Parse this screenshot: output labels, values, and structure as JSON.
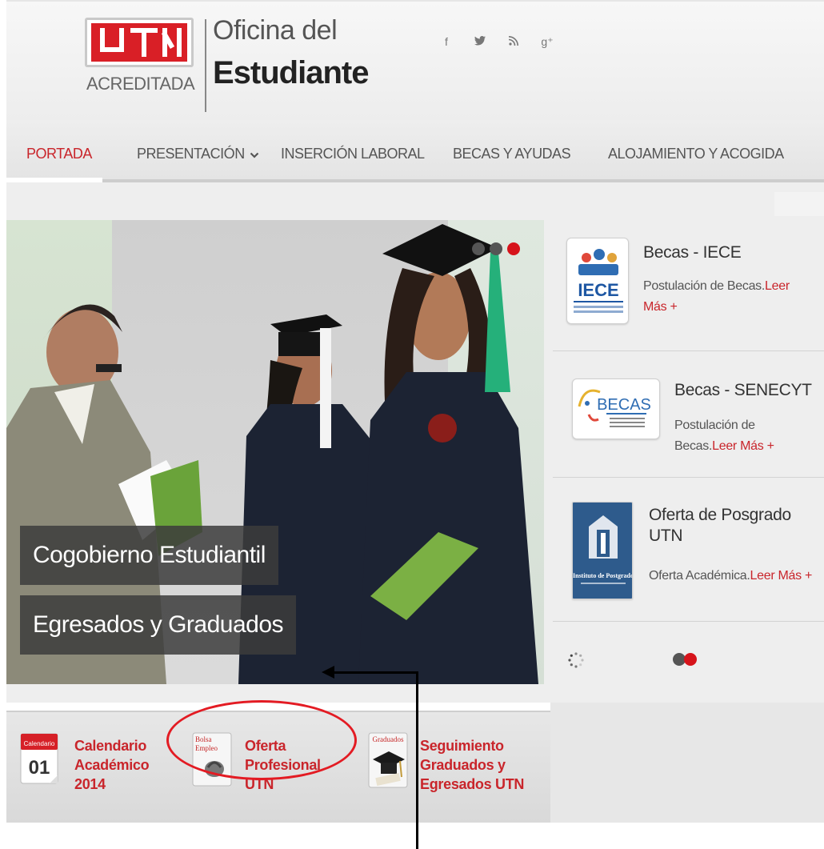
{
  "header": {
    "logo_mark": "UTN",
    "logo_subtitle": "ACREDITADA",
    "title_line1": "Oficina del",
    "title_line2": "Estudiante",
    "social": [
      {
        "icon": "facebook-icon",
        "glyph": "f"
      },
      {
        "icon": "twitter-icon",
        "glyph": "y"
      },
      {
        "icon": "rss-icon",
        "glyph": "≈"
      },
      {
        "icon": "google-plus-icon",
        "glyph": "g⁺"
      }
    ]
  },
  "nav": {
    "items": [
      {
        "label": "PORTADA",
        "active": true
      },
      {
        "label": "PRESENTACIÓN",
        "has_dropdown": true
      },
      {
        "label": "INSERCIÓN LABORAL"
      },
      {
        "label": "BECAS Y AYUDAS"
      },
      {
        "label": "ALOJAMIENTO Y ACOGIDA"
      }
    ],
    "dropdown_glyph": "⌄"
  },
  "slider": {
    "captions": [
      "Cogobierno Estudiantil",
      "Egresados y Graduados"
    ],
    "active_dot": 3,
    "dot_count": 3
  },
  "news": [
    {
      "title": "Becas - IECE",
      "text": "Postulación de Becas.",
      "link": "Leer Más +",
      "thumb_text": "IECE",
      "thumb_sub": "INSTITUTO ECUATORIANO DE CRÉDITO EDUCATIVO Y BECAS"
    },
    {
      "title": "Becas - SENECYT",
      "text": "Postulación de Becas.",
      "link": "Leer Más +",
      "thumb_text": "BECAS",
      "thumb_sub": "Secretaría de Educación Superior, Ciencia y Tecnología"
    },
    {
      "title": "Oferta de Posgrado UTN",
      "text": "Oferta Académica.",
      "link": "Leer Más +",
      "thumb_text": "Instituto de Postgrado",
      "thumb_sub": "Escuela de Posgrado"
    }
  ],
  "bottom": [
    {
      "label_lines": [
        "Calendario",
        "Académico",
        "2014"
      ],
      "icon": "calendar-icon",
      "icon_top": "Calendario",
      "icon_day": "01"
    },
    {
      "label_lines": [
        "Oferta",
        "Profesional",
        "UTN"
      ],
      "icon": "job-board-icon",
      "icon_top": "Bolsa",
      "icon_sub": "Empleo"
    },
    {
      "label_lines": [
        "Seguimiento",
        "Graduados y",
        "Egresados UTN"
      ],
      "icon": "graduation-cap-icon",
      "icon_top": "Graduados"
    }
  ],
  "colors": {
    "accent": "#c9252b",
    "dot_active": "#d6141b",
    "annotation": "#e31b23"
  }
}
